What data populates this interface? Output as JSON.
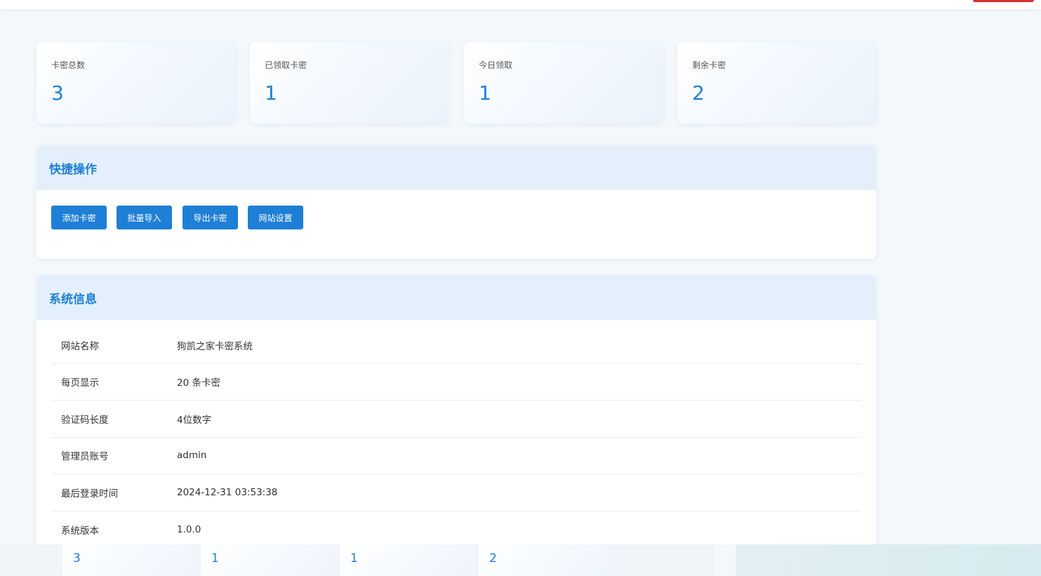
{
  "stats": [
    {
      "label": "卡密总数",
      "value": "3"
    },
    {
      "label": "已领取卡密",
      "value": "1"
    },
    {
      "label": "今日领取",
      "value": "1"
    },
    {
      "label": "剩余卡密",
      "value": "2"
    }
  ],
  "quick_actions": {
    "title": "快捷操作",
    "buttons": [
      "添加卡密",
      "批量导入",
      "导出卡密",
      "网站设置"
    ]
  },
  "system_info": {
    "title": "系统信息",
    "rows": [
      {
        "key": "网站名称",
        "value": "狗凯之家卡密系统"
      },
      {
        "key": "每页显示",
        "value": "20 条卡密"
      },
      {
        "key": "验证码长度",
        "value": "4位数字"
      },
      {
        "key": "管理员账号",
        "value": "admin"
      },
      {
        "key": "最后登录时间",
        "value": "2024-12-31 03:53:38"
      },
      {
        "key": "系统版本",
        "value": "1.0.0"
      }
    ]
  },
  "mini_stats": [
    "3",
    "1",
    "1",
    "2"
  ],
  "colors": {
    "accent": "#1e7fd6",
    "panel_header": "#e3f0fc",
    "page_bg": "#f4f8fb",
    "danger": "#d9302c"
  }
}
